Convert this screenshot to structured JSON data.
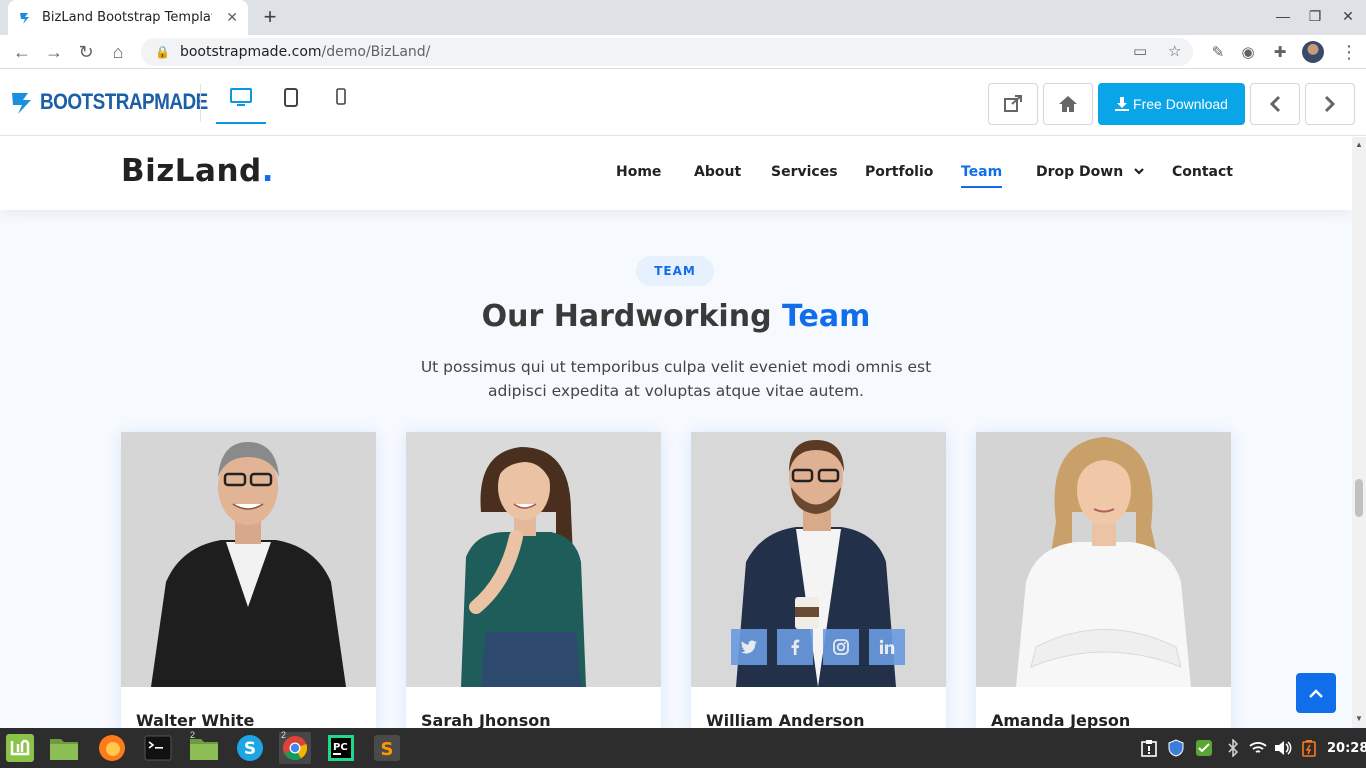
{
  "browser": {
    "tab_title": "BizLand Bootstrap Template | BootstrapMade",
    "new_tab_label": "+",
    "url_host": "bootstrapmade.com",
    "url_path": "/demo/BizLand/"
  },
  "preview_bar": {
    "logo_text": "BOOTSTRAPMADE",
    "download_label": "Free Download",
    "devices": [
      "desktop",
      "tablet",
      "mobile"
    ],
    "active_device": "desktop"
  },
  "site": {
    "brand": "BizLand",
    "brand_dot": ".",
    "nav": [
      {
        "label": "Home"
      },
      {
        "label": "About"
      },
      {
        "label": "Services"
      },
      {
        "label": "Portfolio"
      },
      {
        "label": "Team",
        "active": true
      },
      {
        "label": "Drop Down",
        "dropdown": true
      },
      {
        "label": "Contact"
      }
    ],
    "section_tag": "TEAM",
    "heading_main": "Our Hardworking ",
    "heading_highlight": "Team",
    "subtext": "Ut possimus qui ut temporibus culpa velit eveniet modi omnis est adipisci expedita at voluptas atque vitae autem.",
    "team": [
      {
        "name": "Walter White"
      },
      {
        "name": "Sarah Jhonson"
      },
      {
        "name": "William Anderson"
      },
      {
        "name": "Amanda Jepson"
      }
    ],
    "social_icons": [
      "twitter-icon",
      "facebook-icon",
      "instagram-icon",
      "linkedin-icon"
    ]
  },
  "taskbar": {
    "clock": "20:28",
    "apps": [
      "mint-menu",
      "files",
      "firefox",
      "terminal",
      "files-2",
      "skype",
      "chrome",
      "pycharm",
      "sublime"
    ],
    "chrome_count": "2",
    "files_count": "2"
  },
  "colors": {
    "accent": "#106eea",
    "download_button": "#0aa5e9",
    "section_bg": "#f6f9fe"
  }
}
